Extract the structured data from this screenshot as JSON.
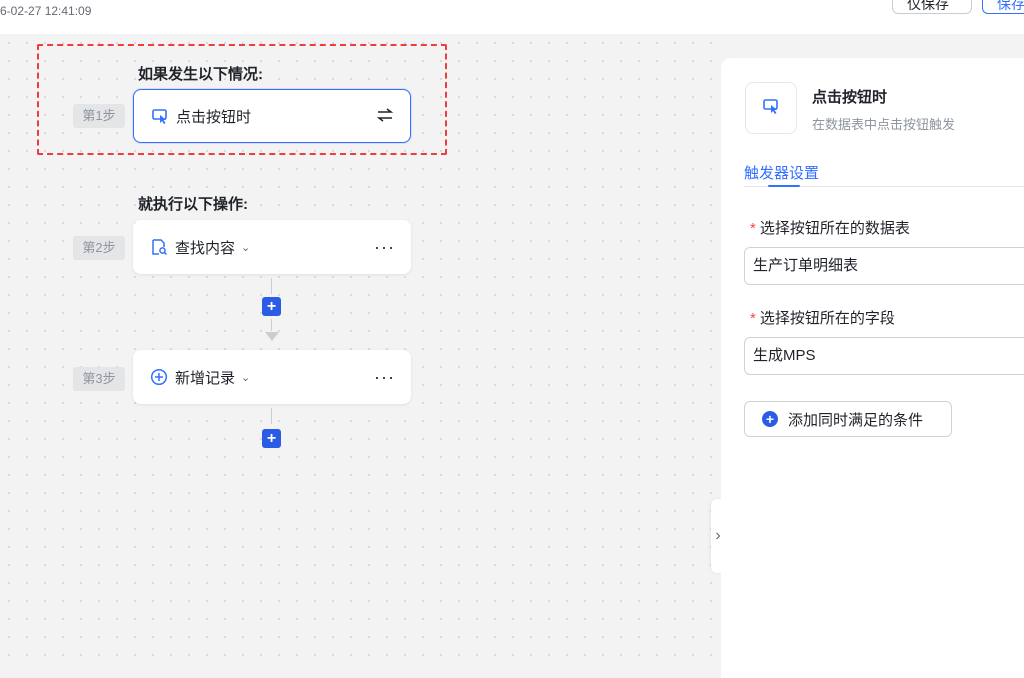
{
  "header": {
    "timestamp": "6-02-27 12:41:09",
    "secondary_button_label": "仅保存",
    "primary_button_label": "保存"
  },
  "flow": {
    "trigger_section_title": "如果发生以下情况:",
    "action_section_title": "就执行以下操作:",
    "steps": [
      {
        "step_label": "第1步",
        "node_label": "点击按钮时",
        "icon": "cursor-click-icon",
        "right_icon": "swap-icon"
      },
      {
        "step_label": "第2步",
        "node_label": "查找内容",
        "icon": "search-document-icon",
        "more": "···"
      },
      {
        "step_label": "第3步",
        "node_label": "新增记录",
        "icon": "plus-circle-icon",
        "more": "···"
      }
    ]
  },
  "panel": {
    "title": "点击按钮时",
    "subtitle": "在数据表中点击按钮触发",
    "tab_label": "触发器设置",
    "fields": [
      {
        "label": "选择按钮所在的数据表",
        "value": "生产订单明细表"
      },
      {
        "label": "选择按钮所在的字段",
        "value": "生成MPS"
      }
    ],
    "add_condition_label": "添加同时满足的条件"
  },
  "colors": {
    "accent": "#3370ff",
    "highlight_dash": "#f03c3c",
    "required": "#f54a45"
  }
}
